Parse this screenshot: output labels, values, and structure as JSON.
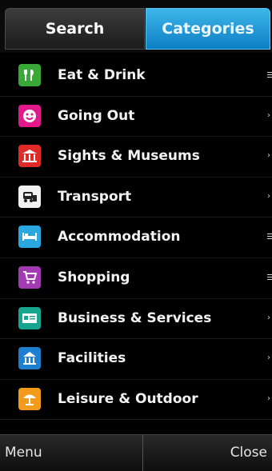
{
  "tabs": {
    "search": "Search",
    "categories": "Categories"
  },
  "categories": [
    {
      "label": "Eat & Drink",
      "icon": "fork-knife-icon",
      "color": "#38a836",
      "indicator": "lines"
    },
    {
      "label": "Going Out",
      "icon": "mask-icon",
      "color": "#e2198b",
      "indicator": "arrow"
    },
    {
      "label": "Sights & Museums",
      "icon": "museum-icon",
      "color": "#e02a27",
      "indicator": "arrow"
    },
    {
      "label": "Transport",
      "icon": "car-icon",
      "color": "#f2f2f2",
      "indicator": "arrow"
    },
    {
      "label": "Accommodation",
      "icon": "bed-icon",
      "color": "#2aa6e0",
      "indicator": "lines"
    },
    {
      "label": "Shopping",
      "icon": "cart-icon",
      "color": "#a23ab1",
      "indicator": "lines"
    },
    {
      "label": "Business & Services",
      "icon": "card-icon",
      "color": "#16a58e",
      "indicator": "arrow"
    },
    {
      "label": "Facilities",
      "icon": "building-icon",
      "color": "#1e7fd0",
      "indicator": "arrow"
    },
    {
      "label": "Leisure & Outdoor",
      "icon": "umbrella-icon",
      "color": "#f29a1c",
      "indicator": "arrow"
    }
  ],
  "softkeys": {
    "left": "Menu",
    "right": "Close"
  }
}
